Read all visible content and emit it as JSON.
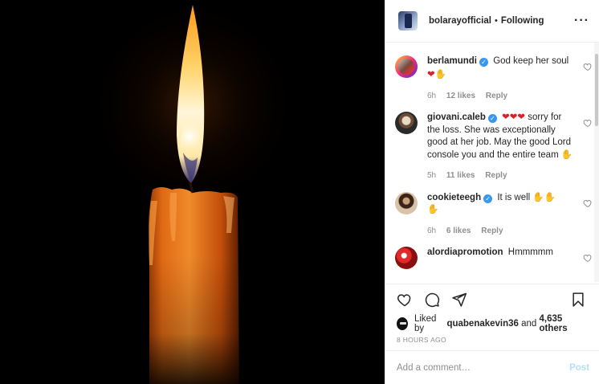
{
  "header": {
    "username": "bolarayofficial",
    "separator": "•",
    "follow_status": "Following",
    "more_icon": "more-horizontal-icon"
  },
  "comments": [
    {
      "username": "berlamundi",
      "verified": true,
      "text": "God keep her soul",
      "emojis": "❤🙏",
      "time": "6h",
      "likes": "12 likes",
      "reply": "Reply"
    },
    {
      "username": "giovani.caleb",
      "verified": true,
      "emojis_lead": "❤❤❤",
      "text": "sorry for the loss. She was exceptionally good at her job. May the good Lord console you and the entire team",
      "emojis_tail": "🙏",
      "time": "5h",
      "likes": "11 likes",
      "reply": "Reply"
    },
    {
      "username": "cookieteegh",
      "verified": true,
      "text": "It is well",
      "emojis": "🙏🙏",
      "emojis_line2": "🙏",
      "time": "6h",
      "likes": "6 likes",
      "reply": "Reply"
    },
    {
      "username": "alordiapromotion",
      "verified": false,
      "text": "Hmmmmm"
    }
  ],
  "likes": {
    "prefix": "Liked by",
    "liker": "quabenakevin36",
    "joiner": "and",
    "others": "4,635 others"
  },
  "timestamp": "8 HOURS AGO",
  "add_comment": {
    "placeholder": "Add a comment…",
    "post_label": "Post"
  },
  "colors": {
    "accent": "#3897f0",
    "post_disabled": "#b2dffc",
    "muted": "#8e8e8e",
    "text": "#262626"
  }
}
